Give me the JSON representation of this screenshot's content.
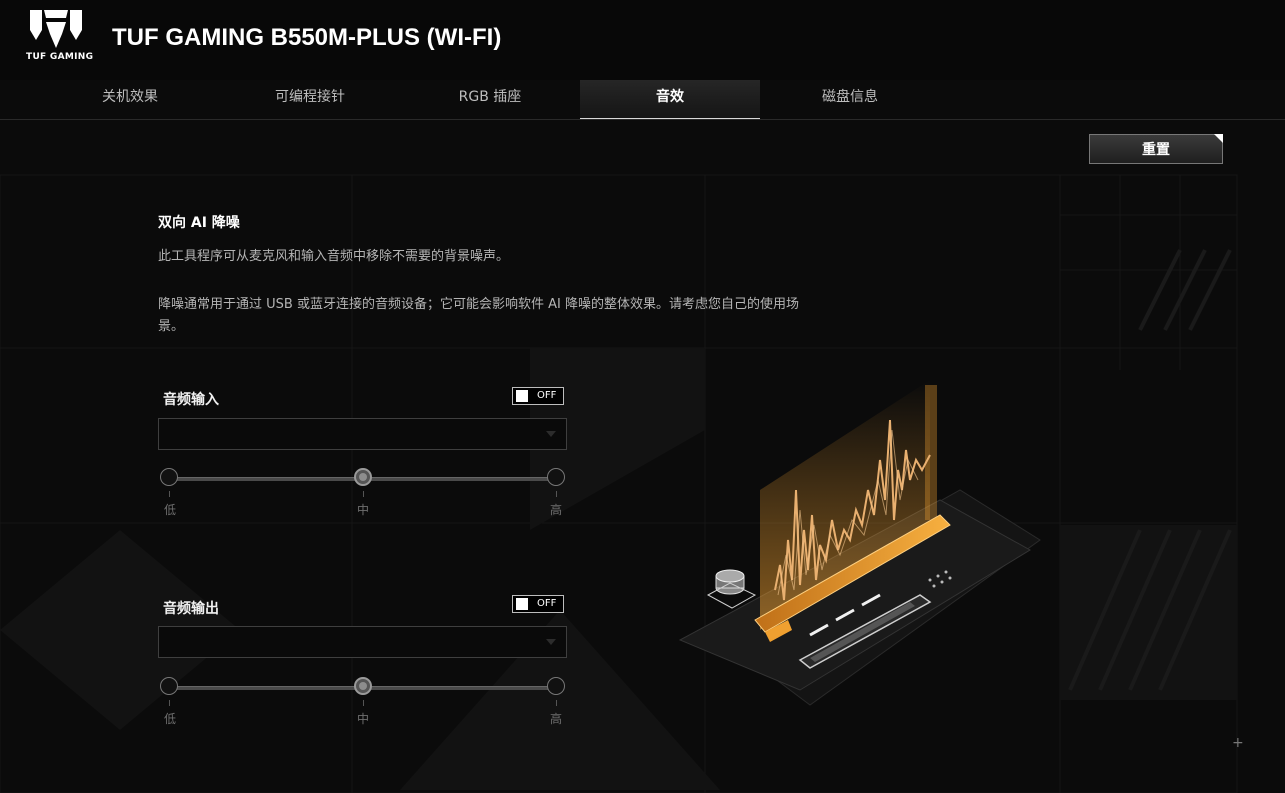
{
  "header": {
    "brand_text": "TUF GAMING",
    "title": "TUF GAMING B550M-PLUS (WI-FI)"
  },
  "tabs": [
    {
      "label": "关机效果",
      "active": false
    },
    {
      "label": "可编程接针",
      "active": false
    },
    {
      "label": "RGB 插座",
      "active": false
    },
    {
      "label": "音效",
      "active": true
    },
    {
      "label": "磁盘信息",
      "active": false
    }
  ],
  "toolbar": {
    "reset_label": "重置"
  },
  "section": {
    "title": "双向 AI 降噪",
    "desc1": "此工具程序可从麦克风和输入音频中移除不需要的背景噪声。",
    "desc2": "降噪通常用于通过 USB 或蓝牙连接的音频设备；它可能会影响软件 AI 降噪的整体效果。请考虑您自己的使用场景。"
  },
  "audio_input": {
    "label": "音频输入",
    "toggle": "OFF",
    "selected": "",
    "levels": [
      "低",
      "中",
      "高"
    ],
    "selected_level": 1
  },
  "audio_output": {
    "label": "音频输出",
    "toggle": "OFF",
    "selected": "",
    "levels": [
      "低",
      "中",
      "高"
    ],
    "selected_level": 1
  },
  "colors": {
    "accent": "#f0a030",
    "background": "#0b0b0b"
  }
}
